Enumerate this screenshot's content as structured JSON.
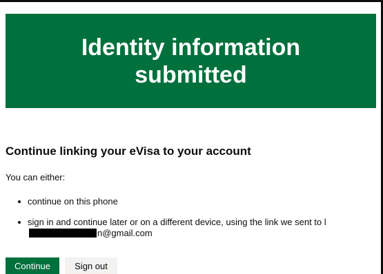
{
  "panel": {
    "title": "Identity information submitted"
  },
  "section": {
    "heading": "Continue linking your eVisa to your account",
    "intro": "You can either:",
    "options": [
      "continue on this phone",
      "sign in and continue later or on a different device, using the link we sent to l"
    ],
    "email_suffix": "n@gmail.com"
  },
  "buttons": {
    "continue": "Continue",
    "sign_out": "Sign out"
  },
  "colors": {
    "panel": "#00703c",
    "primary_button": "#00703c",
    "secondary_button": "#f3f2f1"
  }
}
